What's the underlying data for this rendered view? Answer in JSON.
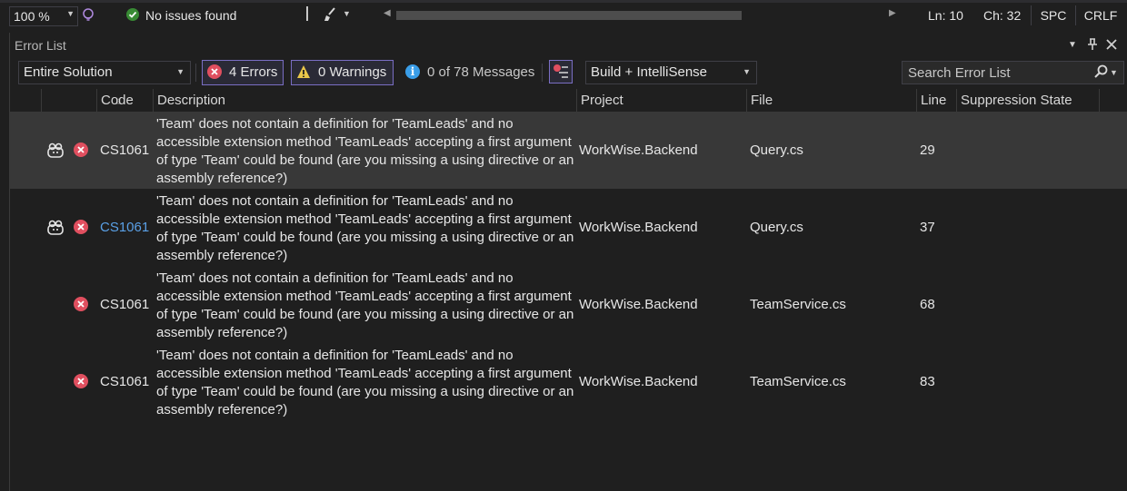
{
  "status": {
    "zoom": "100 %",
    "health": "No issues found",
    "line": "Ln: 10",
    "col": "Ch: 32",
    "whitespace": "SPC",
    "line_ending": "CRLF"
  },
  "panel": {
    "title": "Error List",
    "scope": "Entire Solution",
    "errors_label": "4 Errors",
    "warnings_label": "0 Warnings",
    "messages_label": "0 of 78 Messages",
    "source": "Build + IntelliSense",
    "search_placeholder": "Search Error List"
  },
  "columns": {
    "code": "Code",
    "description": "Description",
    "project": "Project",
    "file": "File",
    "line": "Line",
    "suppression": "Suppression State"
  },
  "rows": [
    {
      "code": "CS1061",
      "desc1": "'Team' does not contain a definition for 'TeamLeads' and no",
      "desc2": "accessible extension method 'TeamLeads' accepting a first argument",
      "desc3": "of type 'Team' could be found (are you missing a using directive or an",
      "desc4": "assembly reference?)",
      "project": "WorkWise.Backend",
      "file": "Query.cs",
      "line": "29"
    },
    {
      "code": "CS1061",
      "desc1": "'Team' does not contain a definition for 'TeamLeads' and no",
      "desc2": "accessible extension method 'TeamLeads' accepting a first argument",
      "desc3": "of type 'Team' could be found (are you missing a using directive or an",
      "desc4": "assembly reference?)",
      "project": "WorkWise.Backend",
      "file": "Query.cs",
      "line": "37"
    },
    {
      "code": "CS1061",
      "desc1": "'Team' does not contain a definition for 'TeamLeads' and no",
      "desc2": "accessible extension method 'TeamLeads' accepting a first argument",
      "desc3": "of type 'Team' could be found (are you missing a using directive or an",
      "desc4": "assembly reference?)",
      "project": "WorkWise.Backend",
      "file": "TeamService.cs",
      "line": "68"
    },
    {
      "code": "CS1061",
      "desc1": "'Team' does not contain a definition for 'TeamLeads' and no",
      "desc2": "accessible extension method 'TeamLeads' accepting a first argument",
      "desc3": "of type 'Team' could be found (are you missing a using directive or an",
      "desc4": "assembly reference?)",
      "project": "WorkWise.Backend",
      "file": "TeamService.cs",
      "line": "83"
    }
  ],
  "icons": {
    "error": "error-circle-x-icon",
    "warning": "warning-triangle-icon",
    "info": "info-circle-icon",
    "copilot": "copilot-icon",
    "search": "search-icon",
    "pin": "pin-icon",
    "close": "close-icon"
  },
  "colors": {
    "error": "#e04f5f",
    "warning": "#e8c64a",
    "info": "#3a9ee8",
    "link": "#5aa0e6",
    "selected_row": "#383838",
    "toggle_border": "#7a6ec4"
  }
}
